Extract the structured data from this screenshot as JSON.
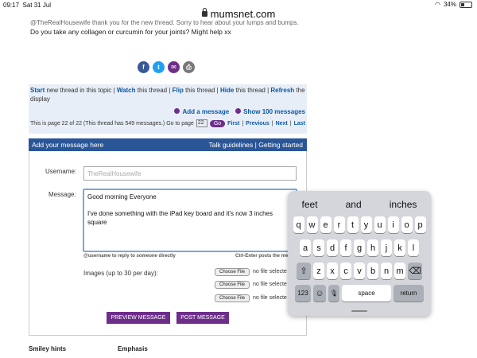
{
  "status": {
    "time": "09:17",
    "date": "Sat 31 Jul",
    "battery": "34%",
    "battery_level": 0.34
  },
  "url": {
    "domain": "mumsnet.com"
  },
  "post": {
    "cut_text": "@TheRealHousewife thank you for the new thread. Sorry to hear about your lumps and bumps.",
    "text": "Do you take any collagen or curcumin for your joints? Might help xx"
  },
  "share": {
    "fb": "f",
    "tw": "t",
    "em": "✉",
    "pr": "⎙"
  },
  "tools": {
    "start": "Start",
    "start_rest": " new thread in this topic | ",
    "watch": "Watch",
    "watch_rest": " this thread | ",
    "flip": "Flip",
    "flip_rest": " this thread | ",
    "hide": "Hide",
    "hide_rest": " this thread | ",
    "refresh": "Refresh",
    "refresh_rest": " the display",
    "add_message": "Add a message",
    "show_100": "Show 100 messages",
    "page_info": "This is page 22 of 22 (This thread has 549 messages.)",
    "goto": "Go to page",
    "page_value": "22",
    "go": "Go",
    "first": "First",
    "previous": "Previous",
    "next": "Next",
    "last": "Last"
  },
  "form": {
    "header": "Add your message here",
    "guidelines": "Talk guidelines",
    "getting_started": "Getting started",
    "username_label": "Username:",
    "username_value": "TheRealHousewife",
    "message_label": "Message:",
    "message_line1": "Good morning Everyone",
    "message_line2": "I've done something with the iPad key board and it's now 3 inches square",
    "hint_left": "@username to reply to someone directly",
    "hint_right": "Ctrl-Enter posts the mess",
    "images_label": "Images (up to 30 per day):",
    "choose_file": "Choose File",
    "no_file": "no file selecte",
    "preview": "PREVIEW MESSAGE",
    "post": "POST MESSAGE"
  },
  "bottom": {
    "smiley": "Smiley hints",
    "emphasis": "Emphasis"
  },
  "keyboard": {
    "suggestions": [
      "feet",
      "and",
      "inches"
    ],
    "row1": [
      "q",
      "w",
      "e",
      "r",
      "t",
      "y",
      "u",
      "i",
      "o",
      "p"
    ],
    "row2": [
      "a",
      "s",
      "d",
      "f",
      "g",
      "h",
      "j",
      "k",
      "l"
    ],
    "row3": [
      "z",
      "x",
      "c",
      "v",
      "b",
      "n",
      "m"
    ],
    "shift": "⇧",
    "backspace": "⌫",
    "numbers": "123",
    "emoji": "☺",
    "mic": "🎙",
    "space": "space",
    "return": "return"
  }
}
